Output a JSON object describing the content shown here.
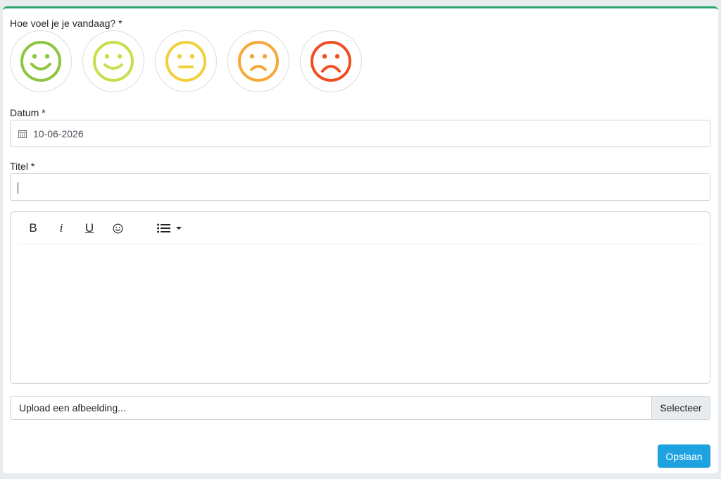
{
  "form": {
    "mood_label": "Hoe voel je je vandaag? *",
    "moods": [
      {
        "name": "very-happy",
        "color": "#8dc63f"
      },
      {
        "name": "happy",
        "color": "#c5df4d"
      },
      {
        "name": "neutral",
        "color": "#f2cf3c"
      },
      {
        "name": "sad",
        "color": "#f5a93a"
      },
      {
        "name": "very-sad",
        "color": "#f04e23"
      }
    ],
    "date_label": "Datum *",
    "date_value": "10-06-2026",
    "date_icon": "calendar-icon",
    "title_label": "Titel *",
    "title_value": ""
  },
  "editor": {
    "toolbar": {
      "bold_label": "B",
      "italic_label": "i",
      "underline_label": "U",
      "emoji_icon": "smiley-icon",
      "list_icon": "bullet-list-icon",
      "dropdown_icon": "caret-down-icon"
    },
    "content": ""
  },
  "upload": {
    "placeholder": "Upload een afbeelding...",
    "browse_label": "Selecteer"
  },
  "actions": {
    "save_label": "Opslaan"
  },
  "colors": {
    "accent_top": "#28a86b",
    "save_button": "#1fa3e0"
  }
}
